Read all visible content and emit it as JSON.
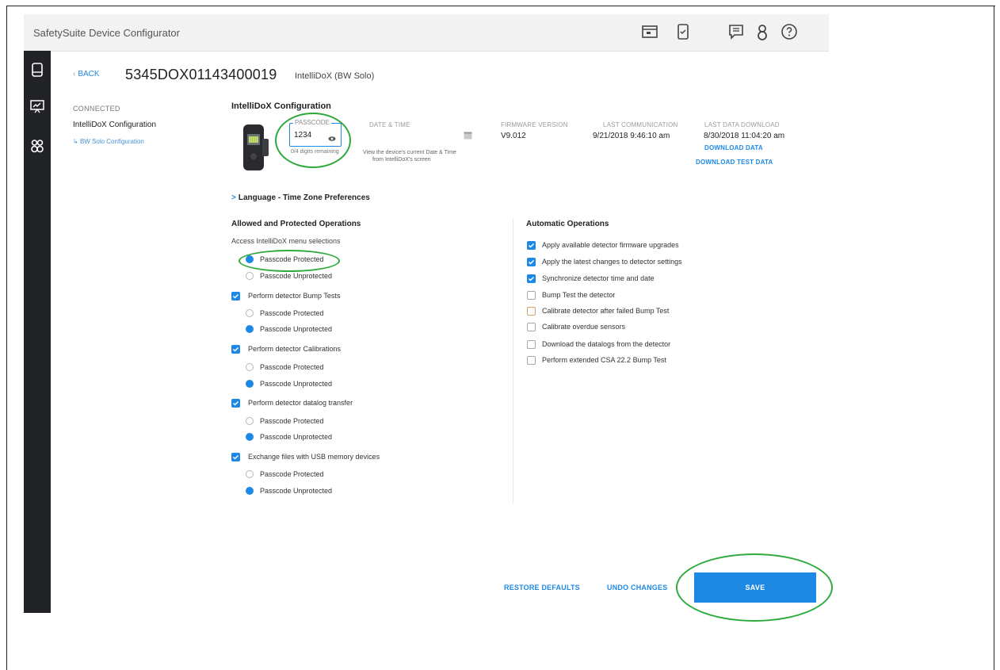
{
  "app": {
    "title": "SafetySuite Device Configurator"
  },
  "toolbar_icons": [
    "calendar-window-icon",
    "device-check-icon",
    "chat-icon",
    "person-icon",
    "help-icon"
  ],
  "sidebar_icons": [
    "device-icon",
    "presentation-chart-icon",
    "people-group-icon"
  ],
  "header": {
    "back_label": "BACK",
    "serial": "5345DOX01143400019",
    "model": "IntelliDoX (BW Solo)"
  },
  "nav": {
    "status": "CONNECTED",
    "item": "IntelliDoX Configuration",
    "subitem": "BW Solo Configuration"
  },
  "config": {
    "title": "IntelliDoX Configuration",
    "passcode_label": "PASSCODE",
    "passcode_value": "1234",
    "passcode_hint": "0/4 digits remaining",
    "date_time_label": "DATE & TIME",
    "date_time_hint_1": "View the device's current Date & Time",
    "date_time_hint_2": "from IntelliDoX's screen",
    "firmware_label": "FIRMWARE VERSION",
    "firmware_value": "V9.012",
    "last_comm_label": "LAST COMMUNICATION",
    "last_comm_value": "9/21/2018 9:46:10 am",
    "last_download_label": "LAST DATA DOWNLOAD",
    "last_download_value": "8/30/2018 11:04:20 am",
    "download_data": "DOWNLOAD DATA",
    "download_test_data": "DOWNLOAD TEST DATA"
  },
  "language_link": "Language - Time Zone Preferences",
  "allowed": {
    "title": "Allowed and Protected Operations",
    "access_caption": "Access IntelliDoX menu selections",
    "access_protected": "Passcode Protected",
    "access_unprotected": "Passcode Unprotected",
    "ops": [
      {
        "label": "Perform detector Bump Tests",
        "protected": "Passcode Protected",
        "unprotected": "Passcode Unprotected"
      },
      {
        "label": "Perform detector Calibrations",
        "protected": "Passcode Protected",
        "unprotected": "Passcode Unprotected"
      },
      {
        "label": "Perform detector datalog transfer",
        "protected": "Passcode Protected",
        "unprotected": "Passcode Unprotected"
      },
      {
        "label": "Exchange files with USB memory devices",
        "protected": "Passcode Protected",
        "unprotected": "Passcode Unprotected"
      }
    ]
  },
  "automatic": {
    "title": "Automatic Operations",
    "items": [
      "Apply available detector firmware upgrades",
      "Apply the latest changes to detector settings",
      "Synchronize detector time and date",
      "Bump Test the detector",
      "Calibrate detector after failed Bump Test",
      "Calibrate overdue sensors",
      "Download the datalogs from the detector",
      "Perform extended CSA 22.2 Bump Test"
    ]
  },
  "actions": {
    "restore": "RESTORE DEFAULTS",
    "undo": "UNDO CHANGES",
    "save": "SAVE"
  },
  "colors": {
    "accent": "#1e88e5",
    "sidebar": "#222326",
    "annotation": "#2eaa3c"
  }
}
